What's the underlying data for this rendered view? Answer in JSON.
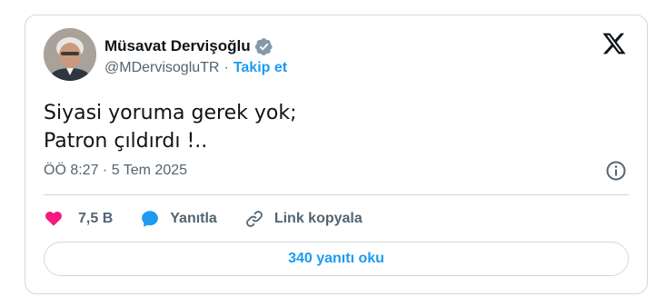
{
  "author": {
    "display_name": "Müsavat Dervişoğlu",
    "handle": "@MDervisogluTR",
    "separator": "·",
    "follow_label": "Takip et",
    "verified_icon": "verified-badge-icon",
    "verified_color": "#829aab"
  },
  "brand": {
    "logo_icon": "x-logo-icon",
    "logo_color": "#0f1419"
  },
  "tweet": {
    "lines": [
      "Siyasi yoruma gerek yok;",
      "Patron çıldırdı !.."
    ]
  },
  "meta": {
    "timestamp": "ÖÖ 8:27 · 5 Tem 2025",
    "info_icon": "info-icon"
  },
  "actions": {
    "like_count": "7,5 B",
    "like_icon": "heart-icon",
    "like_color": "#f91880",
    "reply_label": "Yanıtla",
    "reply_icon": "speech-bubble-icon",
    "reply_color": "#1d9bf0",
    "copy_label": "Link kopyala",
    "copy_icon": "link-icon"
  },
  "footer": {
    "read_replies_label": "340 yanıtı oku"
  },
  "colors": {
    "text": "#0f1419",
    "secondary": "#536471",
    "accent": "#1d9bf0",
    "border": "#cfd9de"
  }
}
